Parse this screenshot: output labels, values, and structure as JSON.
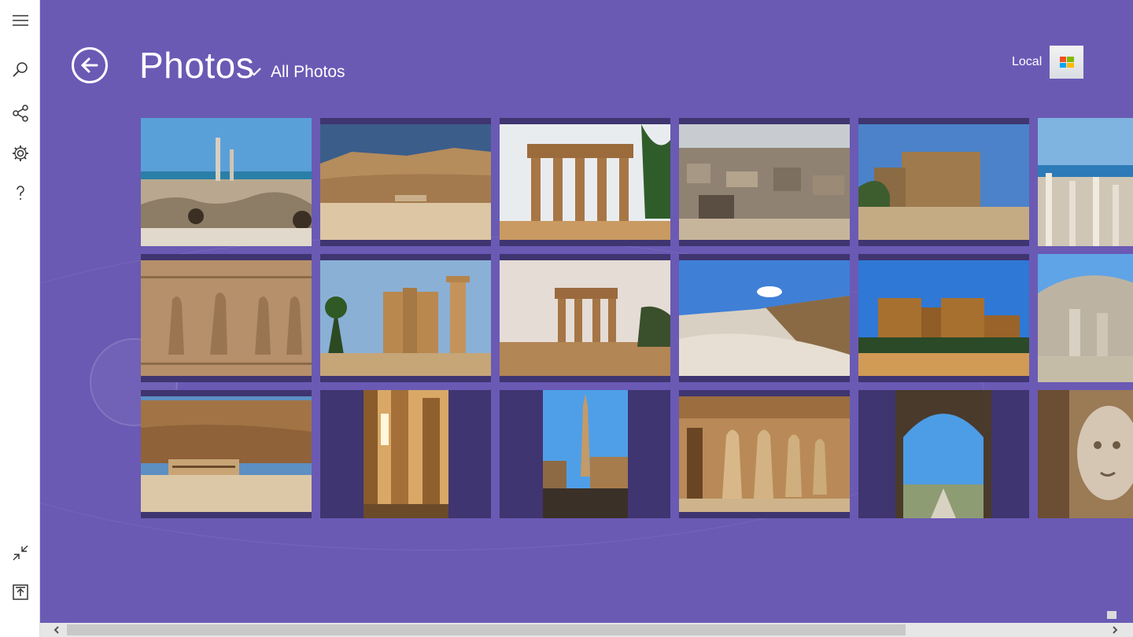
{
  "header": {
    "title": "Photos",
    "subtitle": "All Photos"
  },
  "account": {
    "label": "Local"
  },
  "sidebar": {
    "icons": [
      "menu-icon",
      "search-icon",
      "share-icon",
      "settings-icon",
      "help-icon",
      "collapse-icon",
      "upload-icon"
    ]
  },
  "colors": {
    "background": "#6a5ab4",
    "tile_letterbox": "#3f3570",
    "sidebar": "#ffffff"
  },
  "photos": [
    {
      "subject": "ruins-columns-sea"
    },
    {
      "subject": "desert-cliffs"
    },
    {
      "subject": "temple-kiosk"
    },
    {
      "subject": "city-rooftops"
    },
    {
      "subject": "temple-pylon"
    },
    {
      "subject": "column-ruins-coast"
    },
    {
      "subject": "hieroglyph-relief"
    },
    {
      "subject": "temple-columns-sunset"
    },
    {
      "subject": "temple-kiosk-path"
    },
    {
      "subject": "desert-valley"
    },
    {
      "subject": "temple-facade"
    },
    {
      "subject": "roman-ruins"
    },
    {
      "subject": "hatshepsut-temple"
    },
    {
      "subject": "hypostyle-columns"
    },
    {
      "subject": "obelisk"
    },
    {
      "subject": "osiride-statues"
    },
    {
      "subject": "stone-arch"
    },
    {
      "subject": "medusa-head"
    }
  ]
}
